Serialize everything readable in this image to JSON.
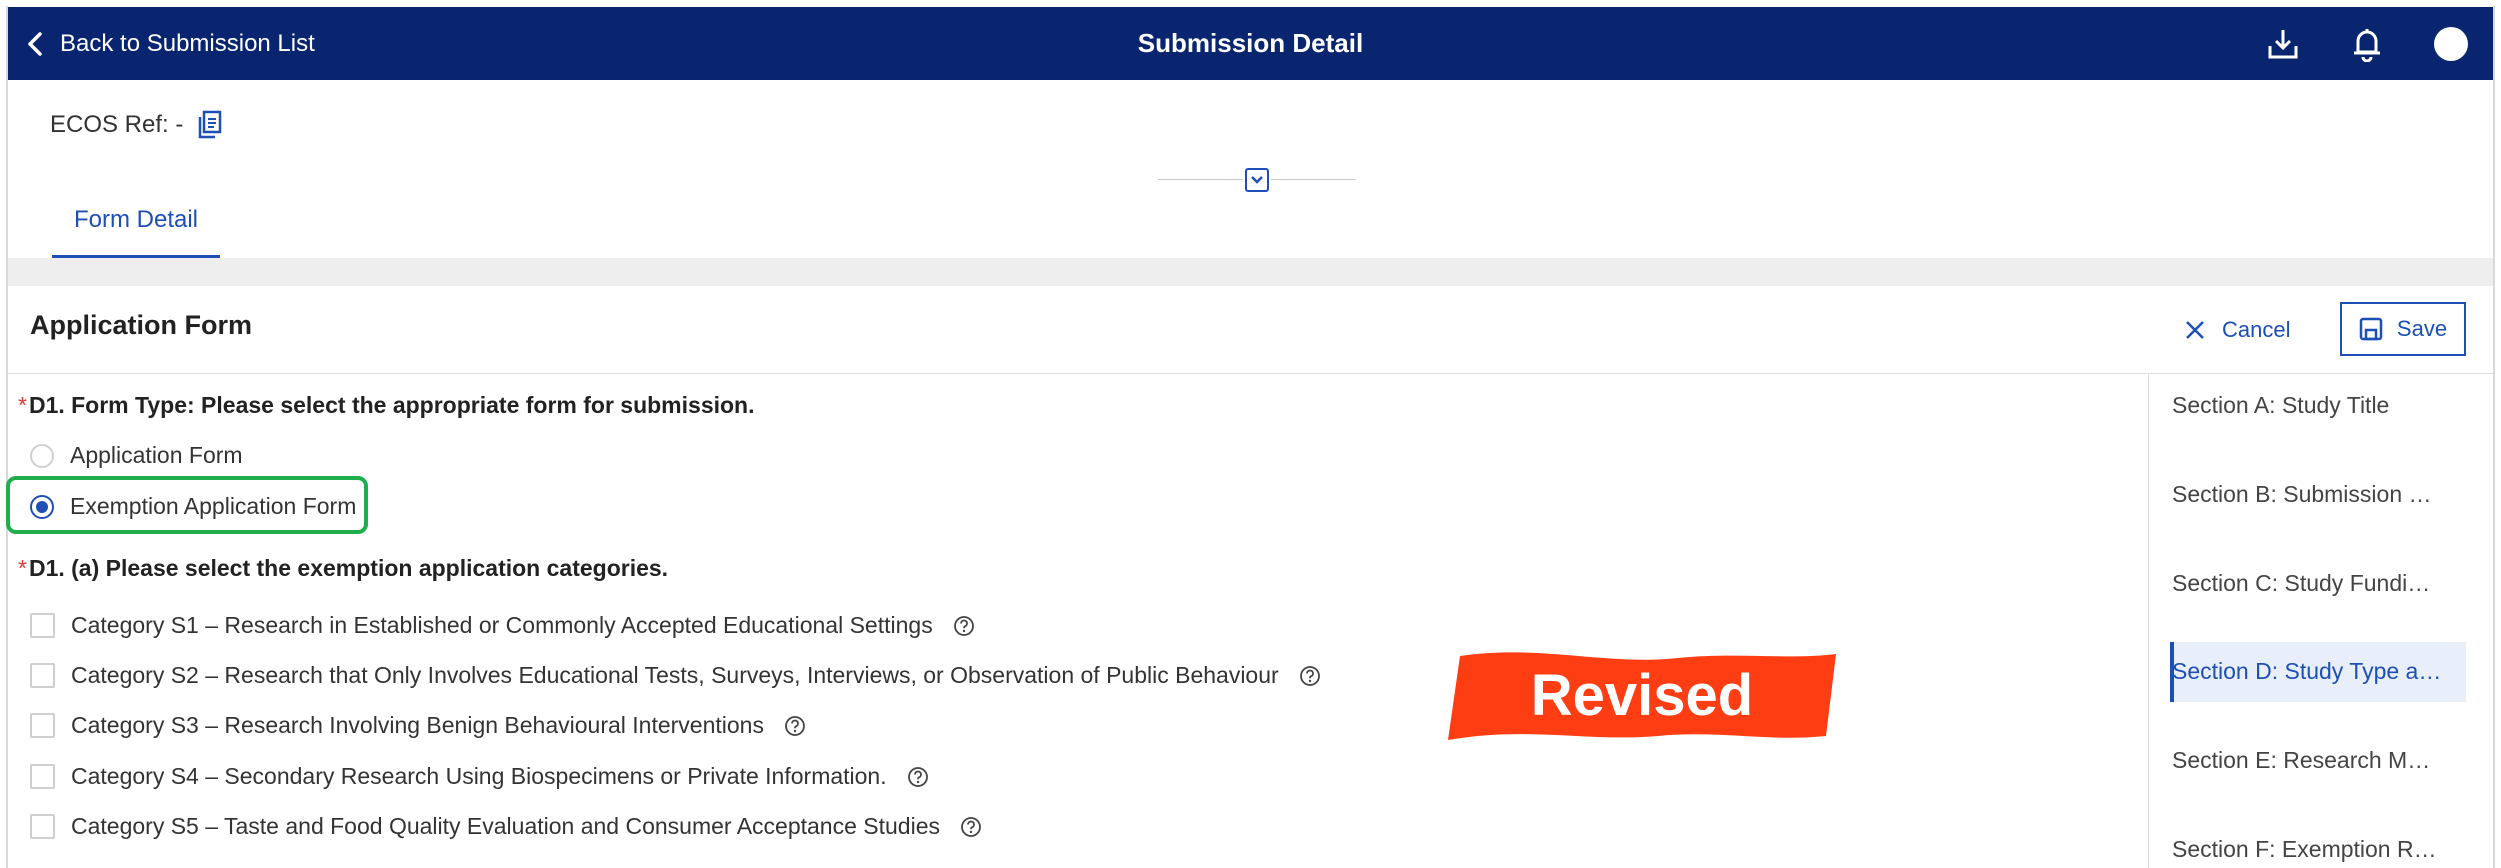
{
  "header": {
    "back_label": "Back to Submission List",
    "title": "Submission Detail",
    "icons": [
      "download-icon",
      "bell-icon",
      "avatar"
    ]
  },
  "info": {
    "ecos_ref": "ECOS Ref: -",
    "copy_icon": "copy-icon"
  },
  "tabs": [
    {
      "label": "Form Detail",
      "active": true
    }
  ],
  "form": {
    "title": "Application Form",
    "cancel_label": "Cancel",
    "save_label": "Save",
    "q1": {
      "required_mark": "*",
      "label": "D1. Form Type: Please select the appropriate form for submission.",
      "options": [
        {
          "label": "Application Form",
          "selected": false
        },
        {
          "label": "Exemption Application Form",
          "selected": true
        }
      ]
    },
    "q2": {
      "required_mark": "*",
      "label": "D1. (a) Please select the exemption application categories.",
      "categories": [
        {
          "label": "Category S1 – Research in Established or Commonly Accepted Educational Settings",
          "checked": false
        },
        {
          "label": "Category S2 – Research that Only Involves Educational Tests, Surveys, Interviews, or Observation of Public Behaviour",
          "checked": false
        },
        {
          "label": "Category S3 – Research Involving Benign Behavioural Interventions",
          "checked": false
        },
        {
          "label": "Category S4 – Secondary Research Using Biospecimens or Private Information.",
          "checked": false
        },
        {
          "label": "Category S5 – Taste and Food Quality Evaluation and Consumer Acceptance Studies",
          "checked": false
        }
      ]
    }
  },
  "sections": [
    {
      "label": "Section A: Study Title",
      "active": false
    },
    {
      "label": "Section B: Submission …",
      "active": false
    },
    {
      "label": "Section C: Study Fundi…",
      "active": false
    },
    {
      "label": "Section D: Study Type a…",
      "active": true
    },
    {
      "label": "Section E: Research M…",
      "active": false
    },
    {
      "label": "Section F: Exemption R…",
      "active": false
    }
  ],
  "annotation": {
    "label": "Revised",
    "color": "#ff3d12"
  },
  "colors": {
    "header_bg": "#0a2570",
    "accent": "#1d4fb5",
    "highlight_border": "#1fae4b",
    "required": "#e53935"
  }
}
